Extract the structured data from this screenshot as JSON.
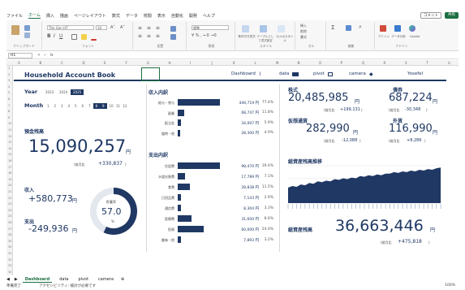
{
  "menu": {
    "items": [
      "ファイル",
      "ホーム",
      "挿入",
      "描画",
      "ページレイアウト",
      "数式",
      "データ",
      "校閲",
      "表示",
      "自動化",
      "開発",
      "ヘルプ"
    ],
    "active_index": 1,
    "comment": "コメント",
    "share": "共有"
  },
  "ribbon": {
    "font_name": "The Gen HT",
    "font_size": "10",
    "number_format": "標準",
    "groups": [
      "クリップボード",
      "フォント",
      "配置",
      "数値",
      "スタイル",
      "セル",
      "編集",
      "アドイン"
    ],
    "style_buttons": [
      "条件付き書式",
      "テーブルとして書式設定",
      "セルのスタイル"
    ],
    "cell_buttons": [
      "挿入",
      "削除",
      "書式"
    ],
    "addins": [
      "アドイン",
      "データ分析",
      "Copilot"
    ]
  },
  "formula_bar": {
    "name_box": "H1",
    "fx": "fx"
  },
  "columns": [
    "A",
    "B",
    "C",
    "D",
    "E",
    "F",
    "G",
    "H",
    "I",
    "J",
    "K",
    "L",
    "M",
    "N",
    "O",
    "P",
    "Q",
    "R",
    "S",
    "T",
    "U"
  ],
  "dashboard": {
    "title": "Household Account Book",
    "nav": [
      {
        "label": "Dashboard",
        "icon": "chart"
      },
      {
        "label": "data",
        "icon": "table"
      },
      {
        "label": "pivot",
        "icon": "grid"
      },
      {
        "label": "camera",
        "icon": "camera"
      }
    ],
    "owner": "Yosefel",
    "year_label": "Year",
    "years": [
      "2023",
      "2024",
      "2025"
    ],
    "selected_year": "2025",
    "month_label": "Month",
    "months": [
      "1",
      "2",
      "3",
      "4",
      "5",
      "6",
      "7",
      "8",
      "9",
      "10",
      "11",
      "12"
    ],
    "selected_months": [
      "8",
      "9"
    ],
    "balance_label": "預金残高",
    "balance": "15,090,257",
    "balance_unit": "円",
    "balance_prev_label": "(前月比",
    "balance_prev": "+330,837",
    "balance_prev_close": ")",
    "income_label": "収入",
    "income": "+580,773",
    "income_unit": "円",
    "expense_label": "支出",
    "expense": "-249,936",
    "expense_unit": "円",
    "rate_label": "貯蓄率",
    "rate": "57.0",
    "rate_unit": "%",
    "rate_value": 57.0,
    "income_detail_label": "収入内訳",
    "income_detail": [
      {
        "cat": "給与・賞与",
        "amount": "449,719 円",
        "pct": "77.4%",
        "value": 449719
      },
      {
        "cat": "副業",
        "amount": "68,747 円",
        "pct": "11.8%",
        "value": 68747
      },
      {
        "cat": "配当金",
        "amount": "34,007 円",
        "pct": "5.9%",
        "value": 34007
      },
      {
        "cat": "臨時・他",
        "amount": "28,300 円",
        "pct": "4.9%",
        "value": 28300
      }
    ],
    "expense_detail_label": "支出内訳",
    "expense_detail": [
      {
        "cat": "住居費",
        "amount": "98,470 円",
        "pct": "39.4%",
        "value": 98470
      },
      {
        "cat": "水道光熱費",
        "amount": "17,789 円",
        "pct": "7.1%",
        "value": 17789
      },
      {
        "cat": "食費",
        "amount": "28,838 円",
        "pct": "11.5%",
        "value": 28838
      },
      {
        "cat": "日用品費",
        "amount": "7,143 円",
        "pct": "2.9%",
        "value": 7143
      },
      {
        "cat": "通信費",
        "amount": "8,304 円",
        "pct": "3.3%",
        "value": 8304
      },
      {
        "cat": "医療費",
        "amount": "31,600 円",
        "pct": "8.6%",
        "value": 31600
      },
      {
        "cat": "投資",
        "amount": "60,000 円",
        "pct": "24.0%",
        "value": 60000
      },
      {
        "cat": "趣味・他",
        "amount": "7,893 円",
        "pct": "3.2%",
        "value": 7893
      }
    ],
    "stocks_label": "株式",
    "stocks": "20,485,985",
    "stocks_unit": "円",
    "stocks_prev_label": "(前月比",
    "stocks_prev": "+199,131",
    "stocks_prev_close": ")",
    "bonds_label": "債券",
    "bonds": "687,224",
    "bonds_unit": "円",
    "bonds_prev_label": "(前月比",
    "bonds_prev": "-30,348",
    "bonds_prev_close": ")",
    "crypto_label": "仮想通貨",
    "crypto": "282,990",
    "crypto_unit": "円",
    "crypto_prev_label": "(前月比",
    "crypto_prev": "-12,088",
    "crypto_prev_close": ")",
    "fx_label": "外貨",
    "fx": "116,990",
    "fx_unit": "円",
    "fx_prev_label": "(前月比",
    "fx_prev": "+8,286",
    "fx_prev_close": ")",
    "trend_label": "総資産残高推移",
    "total_label": "総資産残高",
    "total": "36,663,446",
    "total_unit": "円",
    "total_prev_label": "(前月比",
    "total_prev": "+475,818",
    "total_prev_close": ")"
  },
  "chart_data": {
    "type": "area",
    "title": "総資産残高推移",
    "series": [
      {
        "values": [
          20,
          22,
          21,
          24,
          23,
          26,
          25,
          28,
          27,
          29,
          28,
          31,
          30,
          32,
          31,
          33,
          32,
          35,
          34,
          36,
          35,
          37,
          36,
          38,
          38,
          40,
          39,
          41,
          40,
          42,
          41,
          43,
          42,
          44,
          43,
          45,
          46
        ]
      }
    ]
  },
  "sheets": [
    "Dashboard",
    "data",
    "pivot",
    "camera"
  ],
  "active_sheet": "Dashboard",
  "status": {
    "ready": "準備完了",
    "access": "アクセシビリティ: 検討が必要です",
    "zoom": "100%"
  }
}
